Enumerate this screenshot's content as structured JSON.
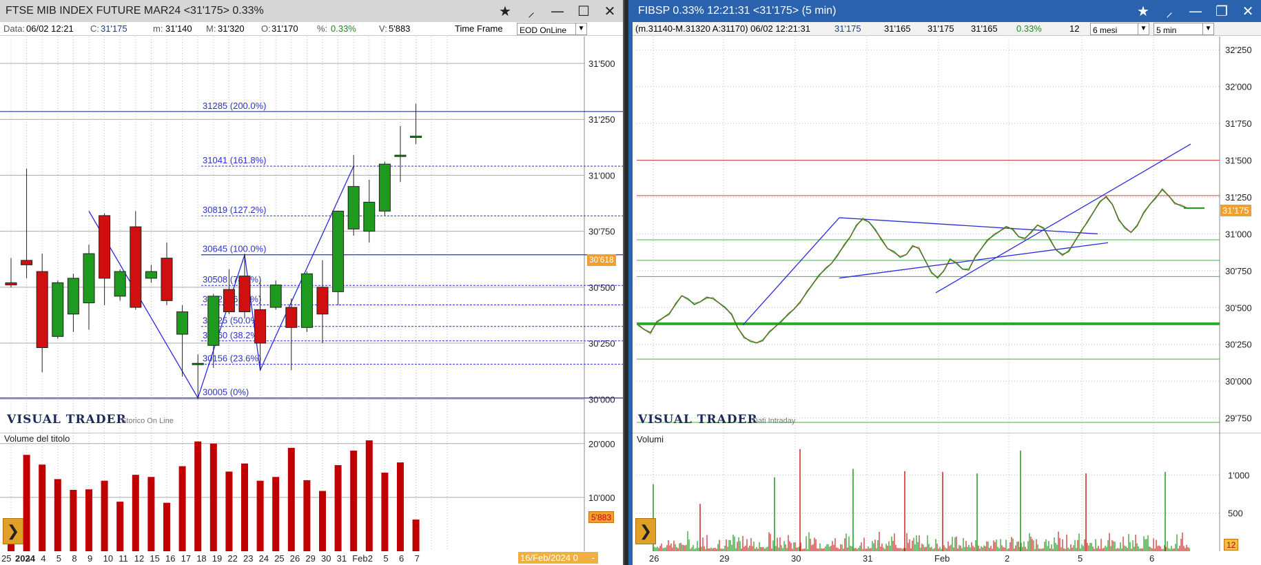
{
  "left": {
    "title": "FTSE MIB INDEX FUTURE MAR24 <31'175> 0.33%",
    "info": {
      "data_label": "Data:",
      "data_value": "06/02 12:21",
      "c_label": "C:",
      "c_value": "31'175",
      "m_label": "m:",
      "m_value": "31'140",
      "M_label": "M:",
      "M_value": "31'320",
      "o_label": "O:",
      "o_value": "31'170",
      "pct_label": "%:",
      "pct_value": "0.33%",
      "v_label": "V:",
      "v_value": "5'883",
      "timeframe_label": "Time Frame",
      "timeframe_value": "EOD OnLine"
    },
    "watermark": "VISUAL TRADER",
    "watermark_sub": "Storico On Line",
    "volume_label": "Volume del titolo",
    "price_badge": "30'618",
    "volume_badge": "5'883",
    "date_badge": "16/Feb/2024 0",
    "date_badge_dash": "-",
    "price_ticks": [
      "31'500",
      "31'250",
      "31'000",
      "30'750",
      "30'500",
      "30'250",
      "30'000"
    ],
    "volume_ticks": [
      "20'000",
      "10'000"
    ],
    "fib_labels": [
      "31285 (200.0%)",
      "31041 (161.8%)",
      "30819 (127.2%)",
      "30645 (100.0%)",
      "30508 (78.6%)",
      "30421 (61.8%)",
      "30325 (50.0%)",
      "30260 (38.2%)",
      "30156 (23.6%)",
      "30005 (0%)"
    ],
    "x_labels": [
      "25",
      "2024",
      "3",
      "4",
      "5",
      "8",
      "9",
      "10",
      "11",
      "12",
      "15",
      "16",
      "17",
      "18",
      "19",
      "22",
      "23",
      "24",
      "25",
      "26",
      "29",
      "30",
      "31",
      "Feb",
      "2",
      "5",
      "6",
      "7"
    ]
  },
  "right": {
    "title": "FIBSP 0.33% 12:21:31 <31'175> (5 min)",
    "info": {
      "range": "(m.31140-M.31320 A:31170) 06/02 12:21:31",
      "last": "31'175",
      "v1": "31'165",
      "v2": "31'175",
      "v3": "31'165",
      "pct": "0.33%",
      "count": "12",
      "period_value": "6 mesi",
      "interval_value": "5 min"
    },
    "watermark": "VISUAL TRADER",
    "watermark_sub": "Dati Intraday",
    "volume_label": "Volumi",
    "price_badge": "31'175",
    "volume_badge": "12",
    "price_ticks": [
      "32'250",
      "32'000",
      "31'750",
      "31'500",
      "31'250",
      "31'000",
      "30'750",
      "30'500",
      "30'250",
      "30'000",
      "29'750"
    ],
    "volume_ticks": [
      "1'000",
      "500"
    ],
    "x_labels": [
      "26",
      "29",
      "30",
      "31",
      "Feb",
      "2",
      "5",
      "6"
    ]
  },
  "chart_data": [
    {
      "type": "candlestick",
      "title": "FTSE MIB INDEX FUTURE MAR24",
      "ylim": [
        29850,
        31620
      ],
      "candles": [
        {
          "o": 30520,
          "h": 30630,
          "l": 30500,
          "c": 30510
        },
        {
          "o": 30620,
          "h": 31030,
          "l": 30540,
          "c": 30600
        },
        {
          "o": 30570,
          "h": 30650,
          "l": 30120,
          "c": 30230
        },
        {
          "o": 30280,
          "h": 30530,
          "l": 30270,
          "c": 30520
        },
        {
          "o": 30380,
          "h": 30560,
          "l": 30300,
          "c": 30540
        },
        {
          "o": 30430,
          "h": 30690,
          "l": 30310,
          "c": 30650
        },
        {
          "o": 30820,
          "h": 30830,
          "l": 30420,
          "c": 30540
        },
        {
          "o": 30460,
          "h": 30580,
          "l": 30440,
          "c": 30570
        },
        {
          "o": 30770,
          "h": 30840,
          "l": 30400,
          "c": 30410
        },
        {
          "o": 30540,
          "h": 30600,
          "l": 30520,
          "c": 30570
        },
        {
          "o": 30630,
          "h": 30700,
          "l": 30420,
          "c": 30440
        },
        {
          "o": 30290,
          "h": 30420,
          "l": 30100,
          "c": 30390
        },
        {
          "o": 30160,
          "h": 30200,
          "l": 30000,
          "c": 30160
        },
        {
          "o": 30240,
          "h": 30470,
          "l": 30140,
          "c": 30460
        },
        {
          "o": 30490,
          "h": 30580,
          "l": 30380,
          "c": 30390
        },
        {
          "o": 30550,
          "h": 30650,
          "l": 30360,
          "c": 30390
        },
        {
          "o": 30400,
          "h": 30530,
          "l": 30130,
          "c": 30250
        },
        {
          "o": 30410,
          "h": 30530,
          "l": 30400,
          "c": 30510
        },
        {
          "o": 30410,
          "h": 30450,
          "l": 30130,
          "c": 30320
        },
        {
          "o": 30320,
          "h": 30570,
          "l": 30300,
          "c": 30560
        },
        {
          "o": 30500,
          "h": 30620,
          "l": 30250,
          "c": 30380
        },
        {
          "o": 30480,
          "h": 30830,
          "l": 30420,
          "c": 30840
        },
        {
          "o": 30760,
          "h": 31090,
          "l": 30730,
          "c": 30950
        },
        {
          "o": 30750,
          "h": 30980,
          "l": 30700,
          "c": 30880
        },
        {
          "o": 30840,
          "h": 31060,
          "l": 30820,
          "c": 31050
        },
        {
          "o": 31090,
          "h": 31220,
          "l": 30970,
          "c": 31090
        },
        {
          "o": 31175,
          "h": 31320,
          "l": 31140,
          "c": 31175
        }
      ],
      "volumes": [
        4400,
        17900,
        16100,
        13400,
        11400,
        11500,
        13100,
        9200,
        14200,
        13800,
        9000,
        15800,
        20400,
        20000,
        14800,
        16300,
        13100,
        13800,
        19200,
        13200,
        11200,
        16000,
        18700,
        20600,
        14600,
        16500,
        5883
      ],
      "fib_levels": [
        31285,
        31041,
        30819,
        30645,
        30508,
        30421,
        30325,
        30260,
        30156,
        30005
      ],
      "volume_ylim": [
        0,
        21000
      ]
    },
    {
      "type": "line",
      "title": "FIBSP",
      "ylim": [
        29650,
        32340
      ],
      "x_start": 26,
      "series": [
        {
          "values": [
            30380,
            30350,
            30330,
            30400,
            30430,
            30460,
            30520,
            30580,
            30560,
            30520,
            30540,
            30570,
            30560,
            30530,
            30500,
            30450,
            30360,
            30300,
            30270,
            30260,
            30280,
            30330,
            30370,
            30410,
            30450,
            30490,
            30540,
            30600,
            30660,
            30720,
            30760,
            30800,
            30860,
            30920,
            30980,
            31060,
            31100,
            31080,
            31030,
            30960,
            30900,
            30880,
            30840,
            30860,
            30920,
            30900,
            30820,
            30740,
            30700,
            30750,
            30830,
            30800,
            30760,
            30760,
            30840,
            30900,
            30960,
            30990,
            31020,
            31050,
            31030,
            30980,
            30970,
            31010,
            31060,
            31040,
            30960,
            30890,
            30860,
            30880,
            30950,
            31020,
            31080,
            31150,
            31220,
            31250,
            31200,
            31100,
            31040,
            31010,
            31060,
            31140,
            31200,
            31250,
            31300,
            31260,
            31210,
            31190,
            31175
          ]
        }
      ],
      "volume_ylim": [
        0,
        1500
      ],
      "volume_peaks": [
        880,
        620,
        970,
        1340,
        1080,
        1040,
        1320,
        1020,
        1040,
        1050,
        1020
      ]
    }
  ]
}
